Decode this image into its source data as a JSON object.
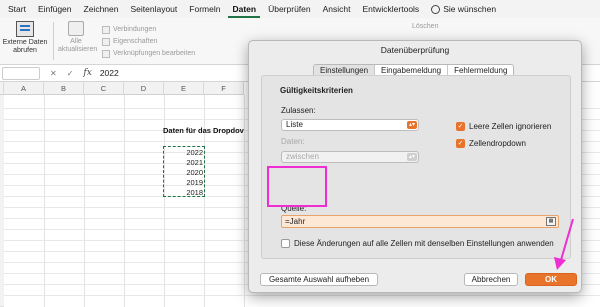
{
  "ribbon_tabs": [
    "Start",
    "Einfügen",
    "Zeichnen",
    "Seitenlayout",
    "Formeln",
    "Daten",
    "Überprüfen",
    "Ansicht",
    "Entwicklertools"
  ],
  "active_tab": "Daten",
  "help_label": "Sie wünschen",
  "ribbon": {
    "external_data": "Externe Daten abrufen",
    "refresh_all": "Alle aktualisieren",
    "connections": [
      "Verbindungen",
      "Eigenschaften",
      "Verknüpfungen bearbeiten"
    ],
    "delete_label": "Löschen"
  },
  "formula_bar": {
    "name_box": "",
    "cancel_icon": "✕",
    "confirm_icon": "✓",
    "fx": "fx",
    "value": "2022"
  },
  "grid": {
    "columns": [
      "A",
      "B",
      "C",
      "D",
      "E",
      "F"
    ],
    "heading": "Daten für das Dropdov",
    "years": [
      "2022",
      "2021",
      "2020",
      "2019",
      "2018"
    ]
  },
  "dialog": {
    "title": "Datenüberprüfung",
    "tabs": [
      "Einstellungen",
      "Eingabemeldung",
      "Fehlermeldung"
    ],
    "active_tab": "Einstellungen",
    "section_title": "Gültigkeitskriterien",
    "allow_label": "Zulassen:",
    "allow_value": "Liste",
    "data_label": "Daten:",
    "data_value": "zwischen",
    "ignore_blank": "Leere Zellen ignorieren",
    "ignore_blank_checked": true,
    "in_cell_dropdown": "Zellendropdown",
    "in_cell_dropdown_checked": true,
    "source_label": "Quelle:",
    "source_value": "=Jahr",
    "apply_all_label": "Diese Änderungen auf alle Zellen mit denselben Einstellungen anwenden",
    "apply_all_checked": false,
    "clear_all_button": "Gesamte Auswahl aufheben",
    "cancel_button": "Abbrechen",
    "ok_button": "OK"
  },
  "colors": {
    "accent_orange": "#e8742c",
    "highlight_magenta": "#ee2ed3",
    "excel_green": "#217346"
  }
}
